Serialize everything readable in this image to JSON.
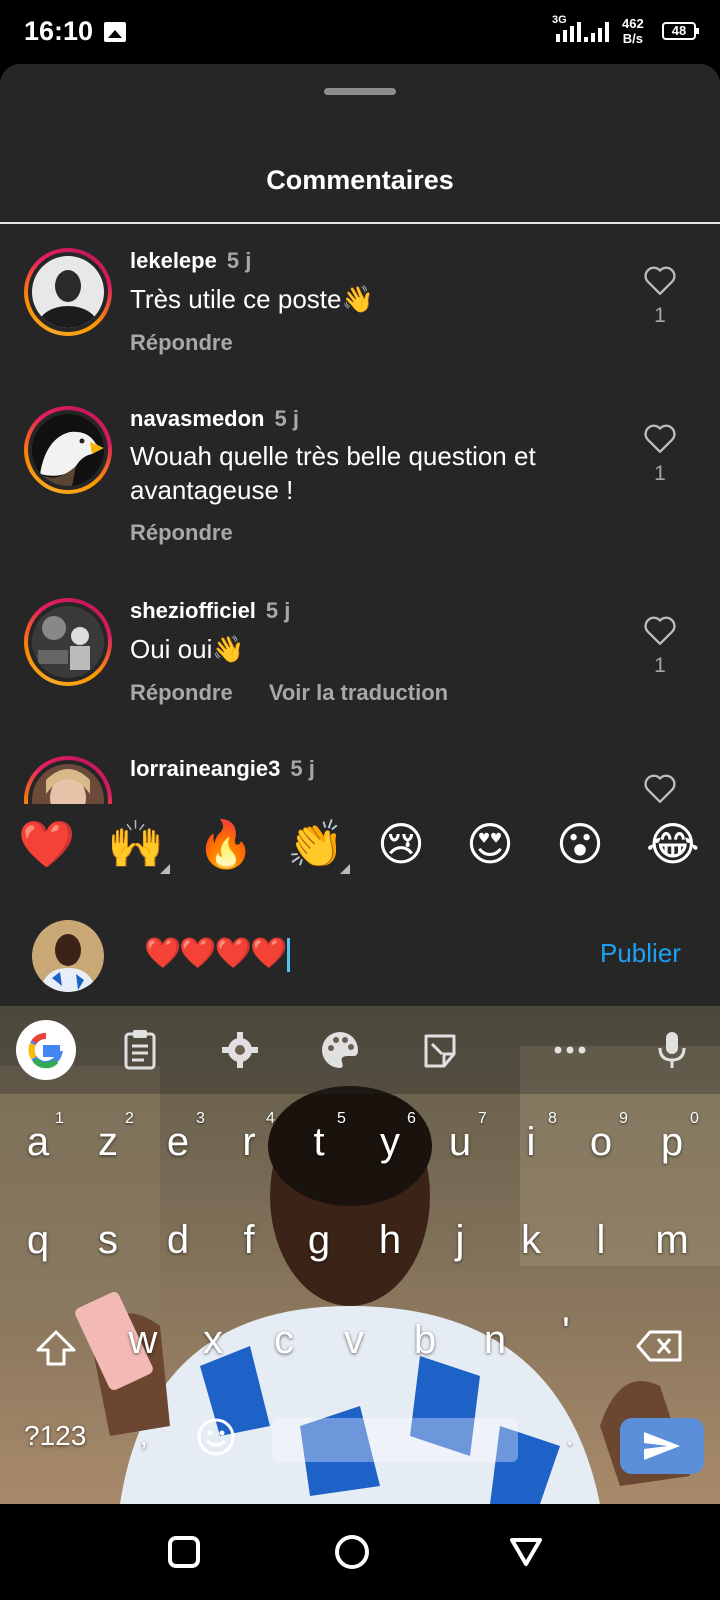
{
  "status_bar": {
    "time": "16:10",
    "network": "3G",
    "speed_value": "462",
    "speed_unit": "B/s",
    "battery": "48"
  },
  "sheet": {
    "title": "Commentaires"
  },
  "comments": [
    {
      "username": "lekelepe",
      "time": "5 j",
      "text": "Très utile ce poste👋",
      "reply_label": "Répondre",
      "likes": "1"
    },
    {
      "username": "navasmedon",
      "time": "5 j",
      "text": "Wouah quelle très belle question et avantageuse !",
      "reply_label": "Répondre",
      "likes": "1"
    },
    {
      "username": "sheziofficiel",
      "time": "5 j",
      "text": "Oui oui👋",
      "reply_label": "Répondre",
      "translate_label": "Voir la traduction",
      "likes": "1"
    },
    {
      "username": "lorraineangie3",
      "time": "5 j"
    }
  ],
  "emoji_bar": [
    "❤️",
    "🙌",
    "🔥",
    "👏",
    "😢",
    "😍",
    "😮",
    "😂"
  ],
  "compose": {
    "input_value": "❤️❤️❤️❤️",
    "publish_label": "Publier"
  },
  "keyboard": {
    "row1": [
      "a",
      "z",
      "e",
      "r",
      "t",
      "y",
      "u",
      "i",
      "o",
      "p"
    ],
    "row1_numbers": [
      "1",
      "2",
      "3",
      "4",
      "5",
      "6",
      "7",
      "8",
      "9",
      "0"
    ],
    "row2": [
      "q",
      "s",
      "d",
      "f",
      "g",
      "h",
      "j",
      "k",
      "l",
      "m"
    ],
    "row3": [
      "w",
      "x",
      "c",
      "v",
      "b",
      "n",
      "'"
    ],
    "symbols_key": "?123",
    "comma_key": ",",
    "period_key": "."
  },
  "colors": {
    "sheet_bg": "#262626",
    "link_blue": "#1da1f2",
    "muted_text": "#a8a8a8"
  }
}
